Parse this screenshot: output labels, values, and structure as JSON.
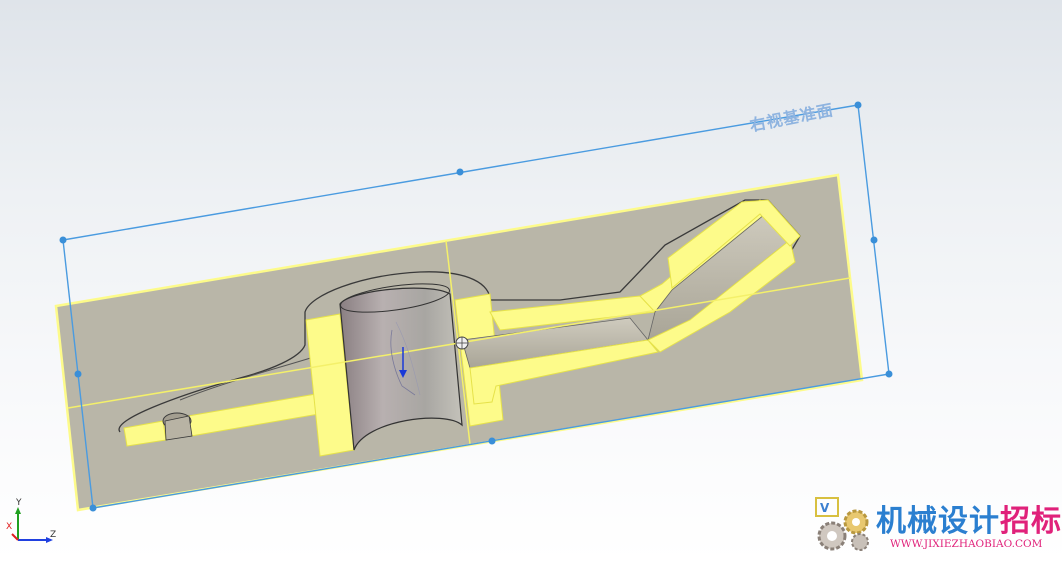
{
  "viewport": {
    "plane_label": "右视基准面"
  },
  "triad": {
    "x_label": "X",
    "y_label": "Y",
    "z_label": "Z",
    "colors": {
      "x": "#e02020",
      "y": "#20a020",
      "z": "#2040e0"
    }
  },
  "watermark": {
    "title_part1": "机械设计",
    "title_part2": "招标网",
    "url": "WWW.JIXIEZHAOBIAO.COM"
  },
  "colors": {
    "section_fill": "#b8b5a6",
    "highlight_yellow": "#fdfb8a",
    "highlight_edge": "#f2ef5a",
    "plane_blue": "#4a9be0",
    "handle_blue": "#3a8fd8"
  }
}
